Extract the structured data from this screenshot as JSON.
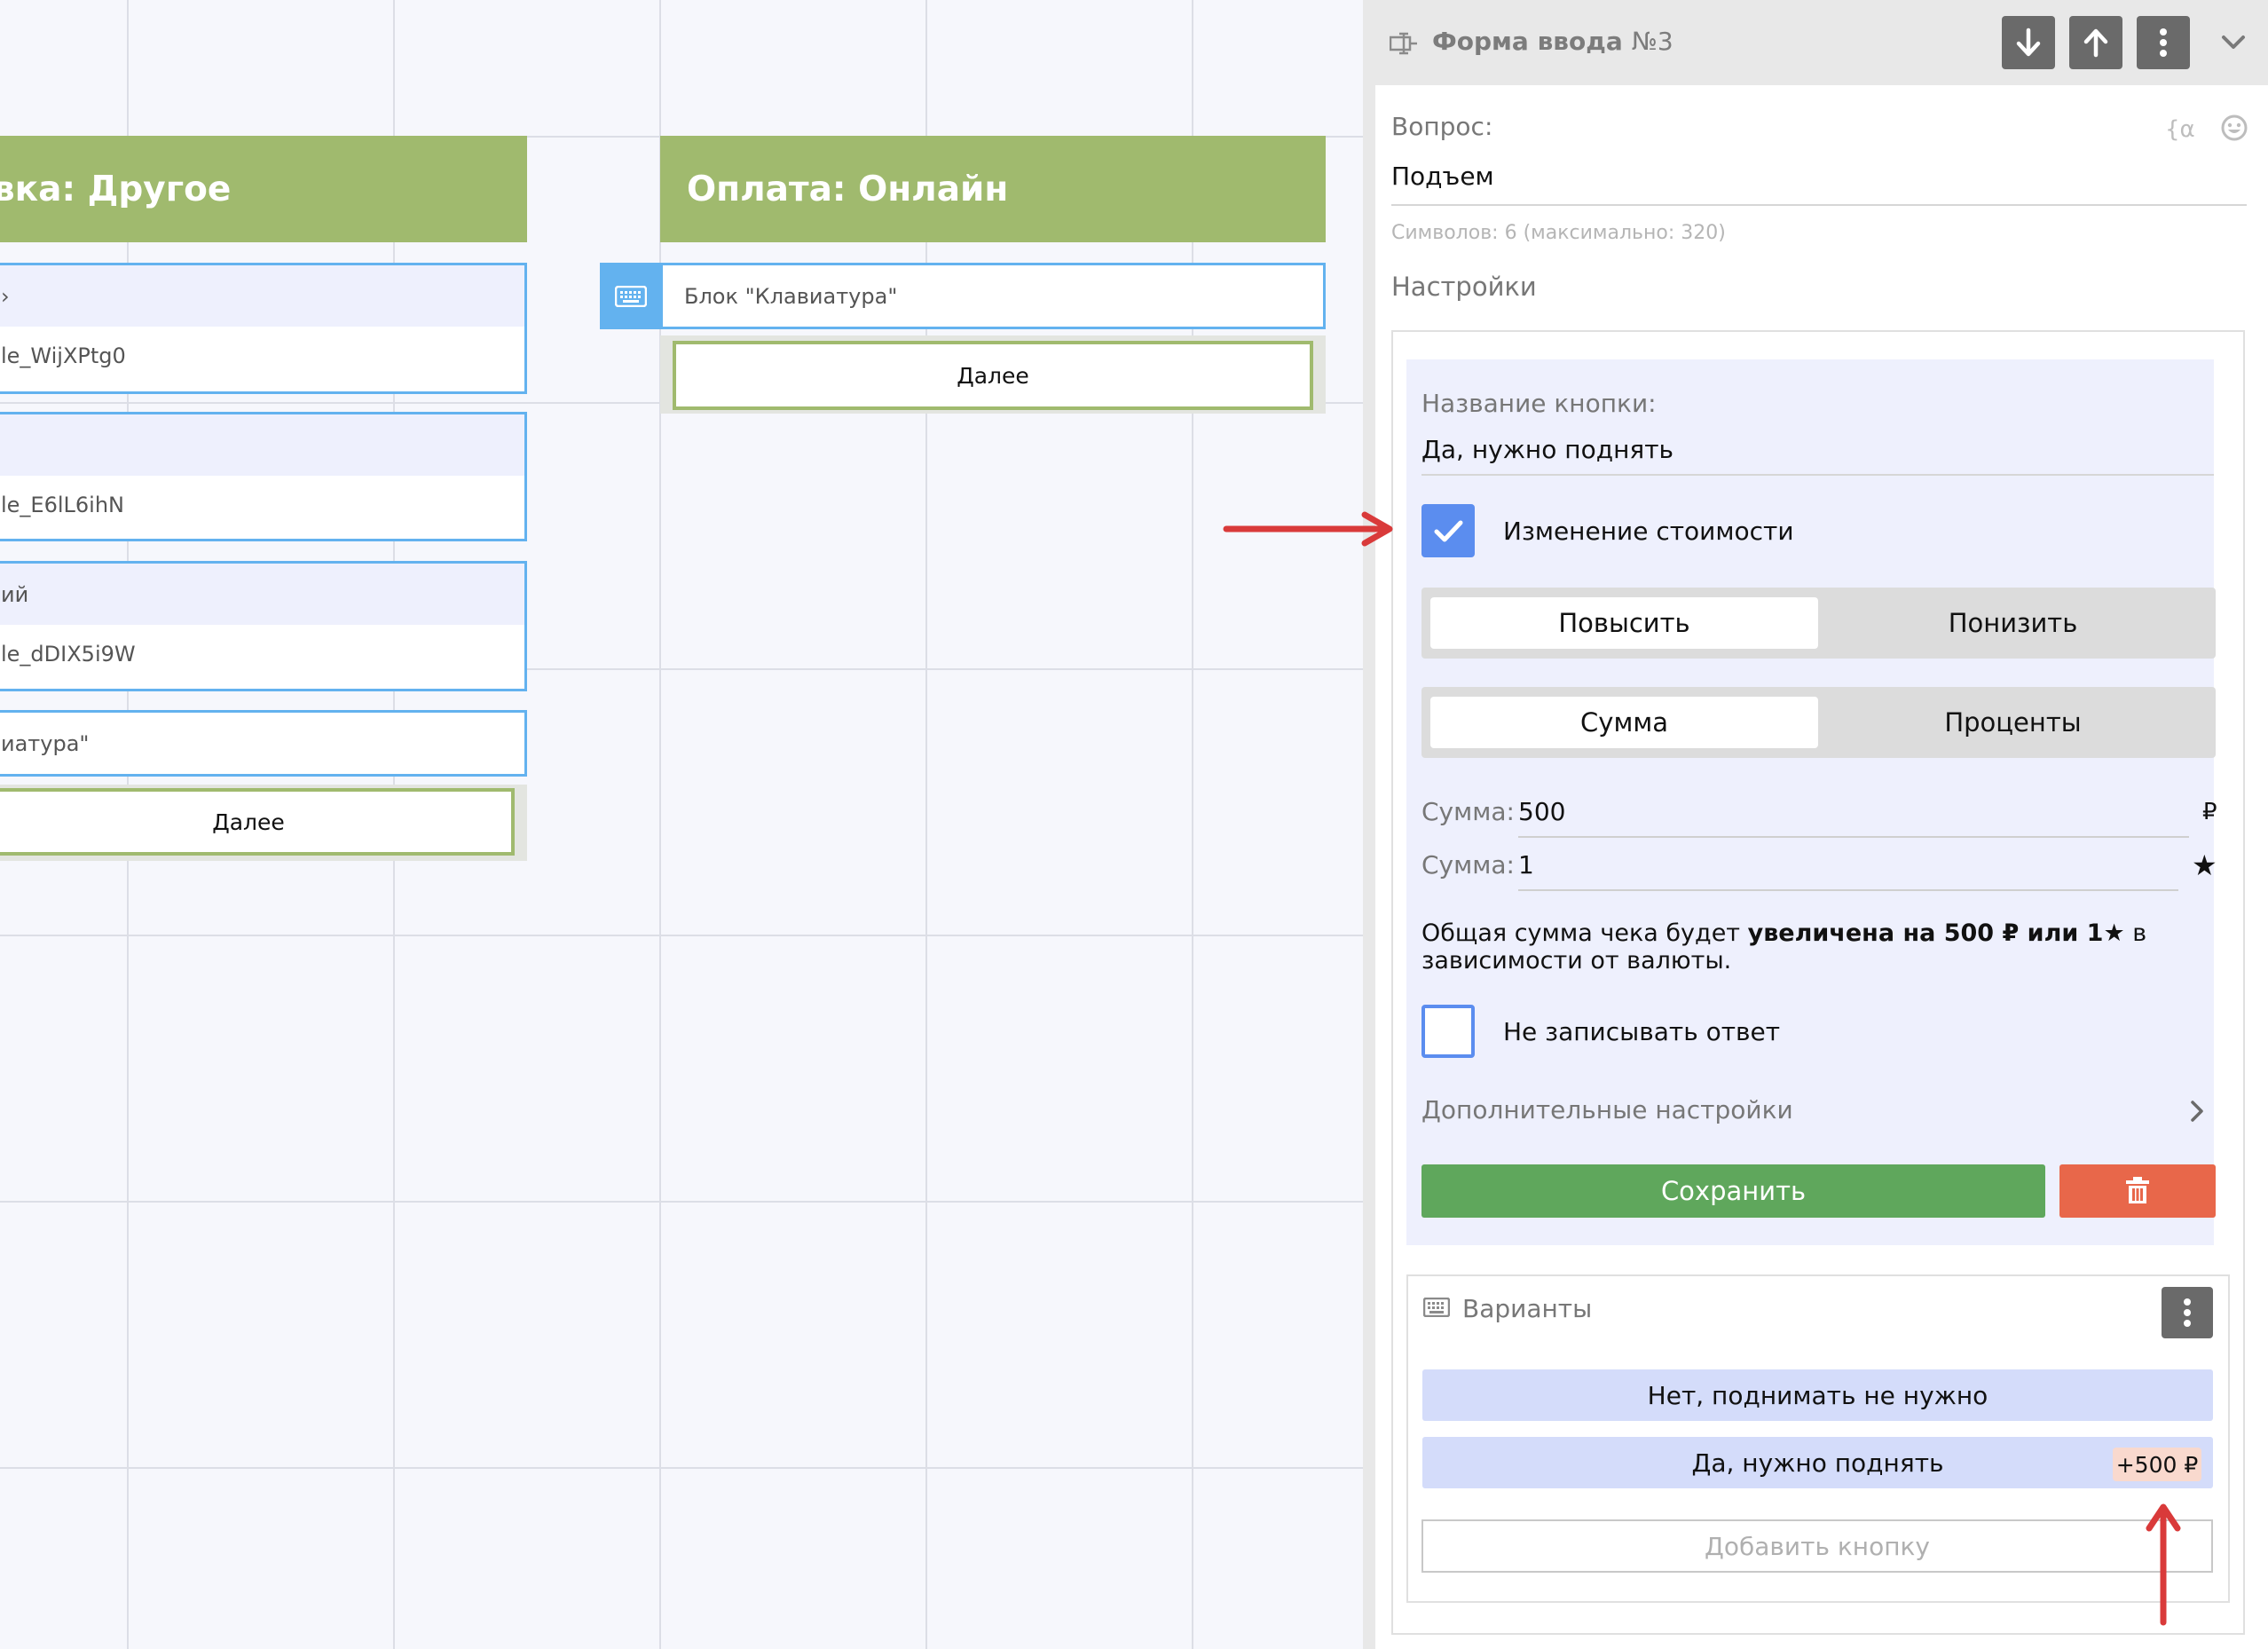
{
  "canvas": {
    "left_node": {
      "title": "вка: Другое",
      "blocks": [
        {
          "top": "›",
          "bottom": "le_WijXPtg0"
        },
        {
          "top": "",
          "bottom": "le_E6lL6ihN"
        },
        {
          "top": "ий",
          "bottom": "le_dDIX5i9W"
        }
      ],
      "keyboard_block": "иатура\"",
      "next_label": "Далее"
    },
    "right_node": {
      "title": "Оплата: Онлайн",
      "keyboard_block": "Блок \"Клавиатура\"",
      "next_label": "Далее"
    }
  },
  "panel": {
    "header": {
      "title": "Форма ввода",
      "number": "№3",
      "icons": [
        "form-icon",
        "arrow-down-icon",
        "arrow-up-icon",
        "more-vertical-icon",
        "chevron-down-icon"
      ]
    },
    "question": {
      "label": "Вопрос:",
      "value": "Подъем",
      "char_count": "Символов: 6 (максимально: 320)"
    },
    "settings_label": "Настройки",
    "button_settings": {
      "name_label": "Название кнопки:",
      "name_value": "Да, нужно поднять",
      "price_change_label": "Изменение стоимости",
      "price_change_checked": true,
      "direction": {
        "options": [
          "Повысить",
          "Понизить"
        ],
        "selected": "Повысить"
      },
      "mode": {
        "options": [
          "Сумма",
          "Проценты"
        ],
        "selected": "Сумма"
      },
      "amount_rub": {
        "label": "Сумма:",
        "value": "500",
        "currency": "₽"
      },
      "amount_star": {
        "label": "Сумма:",
        "value": "1",
        "currency": "★"
      },
      "summary_prefix": "Общая сумма чека будет ",
      "summary_bold": "увеличена на 500 ₽ или 1★",
      "summary_suffix": " в зависимости от валюты.",
      "no_record_label": "Не записывать ответ",
      "no_record_checked": false,
      "advanced_label": "Дополнительные настройки",
      "save_label": "Сохранить"
    },
    "variants": {
      "title": "Варианты",
      "items": [
        {
          "label": "Нет, поднимать не нужно",
          "badge": ""
        },
        {
          "label": "Да, нужно поднять",
          "badge": "+500 ₽"
        }
      ],
      "add_label": "Добавить кнопку"
    }
  },
  "colors": {
    "node_header": "#a0ba6e",
    "block_border": "#63b2ef",
    "accent_blue": "#5b8def",
    "save_green": "#5fa75c",
    "delete_red": "#e8674a",
    "annotation_red": "#d93a3a"
  }
}
